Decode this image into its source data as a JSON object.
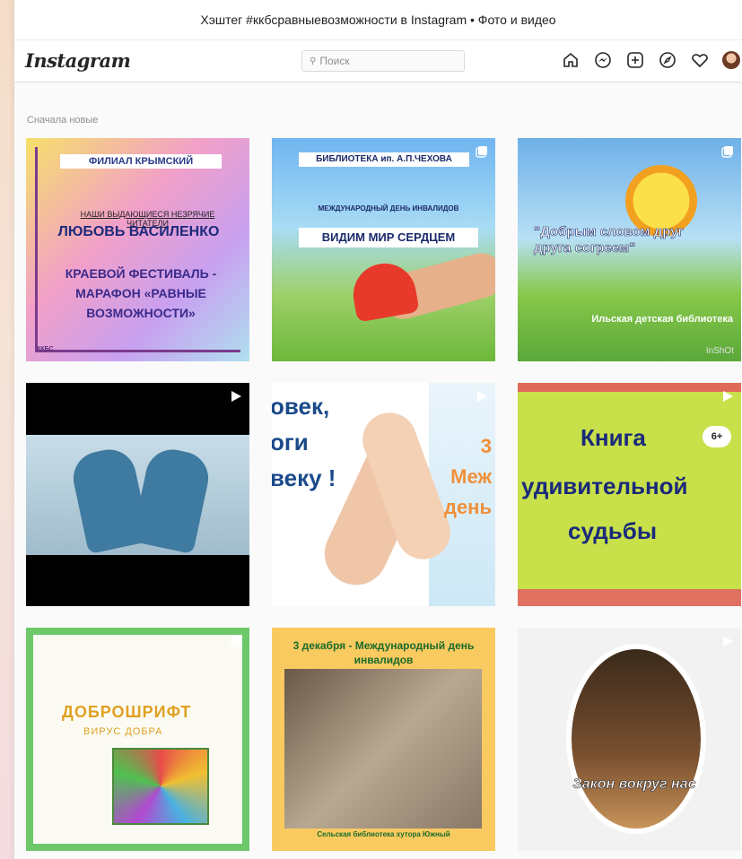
{
  "window": {
    "title": "Хэштег #ккбсравныевозможности в Instagram • Фото и видео"
  },
  "nav": {
    "logo": "Instagram",
    "search_placeholder": "Поиск",
    "icons": [
      "home-icon",
      "messenger-icon",
      "new-post-icon",
      "explore-icon",
      "activity-heart-icon",
      "profile-avatar"
    ]
  },
  "feed": {
    "sort_label": "Сначала новые",
    "posts": [
      {
        "header": "ФИЛИАЛ КРЫМСКИЙ",
        "line1": "НАШИ ВЫДАЮЩИЕСЯ НЕЗРЯЧИЕ ЧИТАТЕЛИ",
        "line2": "ЛЮБОВЬ ВАСИЛЕНКО",
        "line3": "КРАЕВОЙ ФЕСТИВАЛЬ - МАРАФОН «РАВНЫЕ ВОЗМОЖНОСТИ»",
        "logo_text": "ККБС"
      },
      {
        "header": "БИБЛИОТЕКА ип. А.П.ЧЕХОВА",
        "line1": "МЕЖДУНАРОДНЫЙ ДЕНЬ ИНВАЛИДОВ",
        "line2": "ВИДИМ МИР СЕРДЦЕМ",
        "badge": "carousel"
      },
      {
        "line1": "\"Добрым словом друг друга согреем\"",
        "line2": "Ильская детская библиотека",
        "watermark": "InShOt",
        "badge": "carousel"
      },
      {
        "badge": "video"
      },
      {
        "line1": "овек, оги веку !",
        "line2": "3 Меж день",
        "badge": "video"
      },
      {
        "line1": "Книга",
        "line2": "удивительной",
        "line3": "судьбы",
        "age": "6+",
        "badge": "video"
      },
      {
        "line1": "ДОБРОШРИФТ",
        "line2": "ВИРУС ДОБРА",
        "badge": "carousel"
      },
      {
        "line1": "3 декабря - Международный день инвалидов",
        "line2": "Сельская библиотека хутора Южный"
      },
      {
        "line1": "Закон вокруг нас",
        "badge": "video"
      }
    ]
  }
}
